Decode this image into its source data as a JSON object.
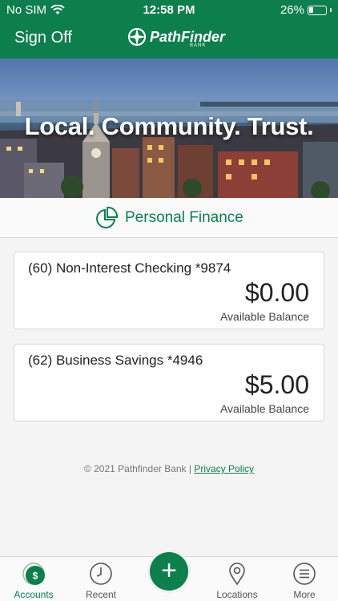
{
  "status_bar": {
    "carrier": "No SIM",
    "time": "12:58 PM",
    "battery": "26%",
    "battery_level": 0.26
  },
  "header": {
    "sign_off": "Sign Off",
    "logo_text": "PathFinder",
    "logo_subtext": "BANK",
    "brand_color": "#0c7f4c"
  },
  "hero": {
    "tagline": "Local. Community. Trust."
  },
  "section": {
    "title": "Personal Finance",
    "icon": "pie-chart-icon"
  },
  "accounts": [
    {
      "name": "(60) Non-Interest Checking *9874",
      "balance": "$0.00",
      "balance_label": "Available Balance"
    },
    {
      "name": "(62) Business Savings *4946",
      "balance": "$5.00",
      "balance_label": "Available Balance"
    }
  ],
  "footer": {
    "copyright": "© 2021 Pathfinder Bank |",
    "privacy_link": "Privacy Policy"
  },
  "tabbar": {
    "tabs": [
      {
        "label": "Accounts",
        "icon": "dollar-icon",
        "active": true
      },
      {
        "label": "Recent",
        "icon": "clock-icon",
        "active": false
      },
      {
        "label": "Locations",
        "icon": "location-pin-icon",
        "active": false
      },
      {
        "label": "More",
        "icon": "menu-icon",
        "active": false
      }
    ],
    "fab_icon": "plus-icon",
    "fab_label": "+"
  }
}
